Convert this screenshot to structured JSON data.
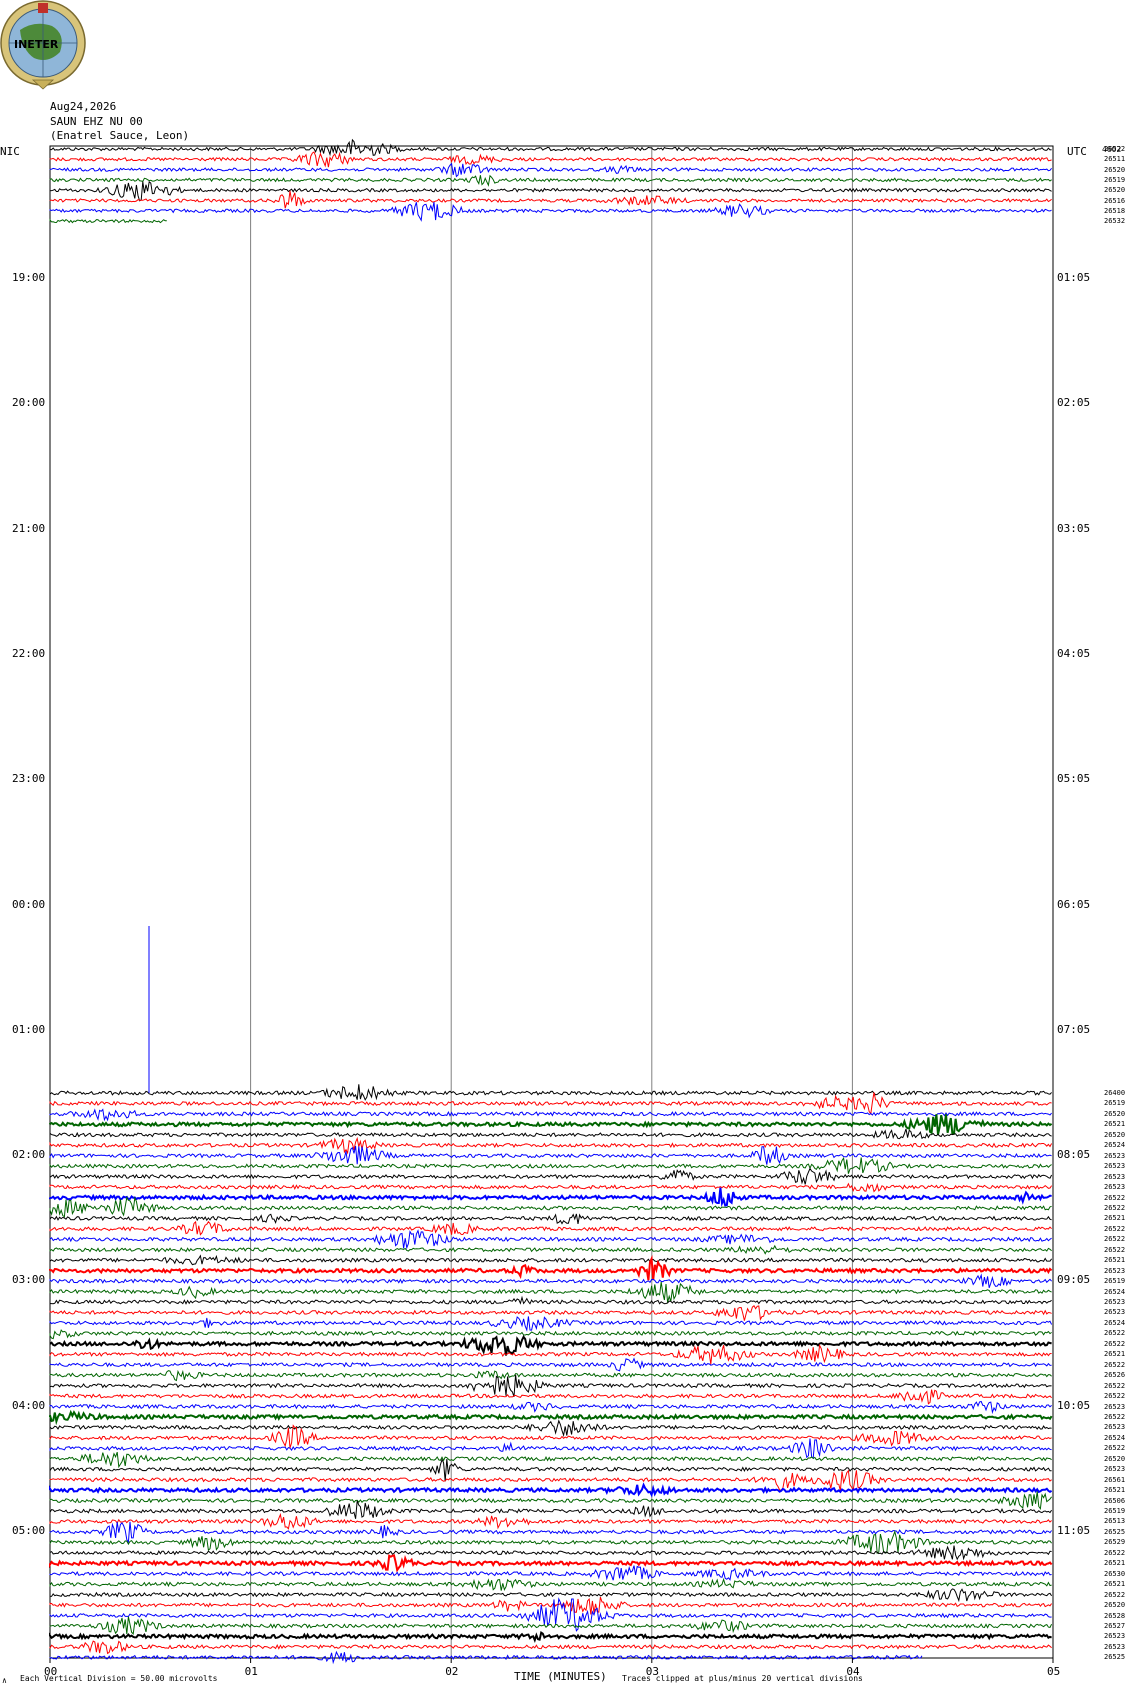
{
  "header": {
    "logo_text": "INETER",
    "date": "Aug24,2026",
    "station": "SAUN EHZ NU 00",
    "location": "(Enatrel Sauce, Leon)",
    "left_tz": "NIC",
    "right_tz": "UTC"
  },
  "chart_data": {
    "type": "line",
    "xlabel": "TIME (MINUTES)",
    "x_ticks": [
      "00",
      "01",
      "02",
      "03",
      "04",
      "05"
    ],
    "xlim": [
      0,
      5
    ],
    "left_time_labels": [
      "19:00",
      "20:00",
      "21:00",
      "22:00",
      "23:00",
      "00:00",
      "01:00",
      "02:00",
      "03:00",
      "04:00",
      "05:00"
    ],
    "right_time_labels": [
      "01:05",
      "02:05",
      "03:05",
      "04:05",
      "05:05",
      "06:05",
      "07:05",
      "08:05",
      "09:05",
      "10:05",
      "11:05"
    ],
    "trace_colors": [
      "#000000",
      "#ff0000",
      "#0000ff",
      "#006400"
    ],
    "top_group_counts": [
      "26522",
      "26511",
      "26520",
      "26519",
      "26520",
      "26516",
      "26518",
      "26532"
    ],
    "top_group_extra_label": "4602",
    "bottom_group_counts": [
      "26400",
      "26519",
      "26520",
      "26521",
      "26520",
      "26524",
      "26523",
      "26523",
      "26523",
      "26523",
      "26522",
      "26522",
      "26521",
      "26522",
      "26522",
      "26522",
      "26521",
      "26523",
      "26519",
      "26524",
      "26523",
      "26523",
      "26524",
      "26522",
      "26522",
      "26521",
      "26522",
      "26526",
      "26522",
      "26522",
      "26523",
      "26522",
      "26523",
      "26524",
      "26522",
      "26520",
      "26523",
      "26561",
      "26521",
      "26506",
      "26519",
      "26513",
      "26525",
      "26529",
      "26522",
      "26521",
      "26530",
      "26521",
      "26522",
      "26520",
      "26528",
      "26527",
      "26523",
      "26523",
      "26525"
    ],
    "footer_left": "Each Vertical Division =   50.00 microvolts",
    "footer_right": "Traces clipped at plus/minus 20 vertical divisions",
    "footer_corner": "∧"
  }
}
